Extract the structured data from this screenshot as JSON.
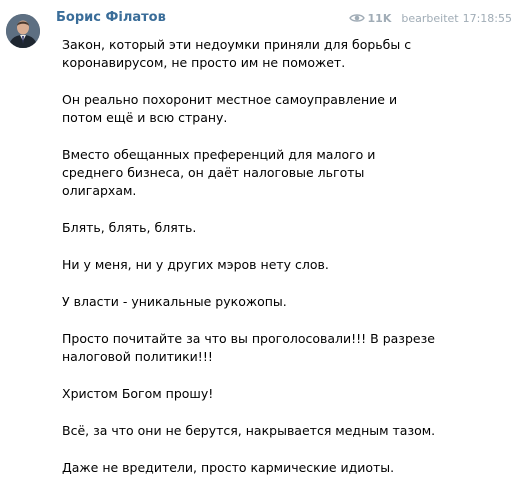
{
  "message": {
    "author": "Борис Філатов",
    "views": "11K",
    "signature": "bearbeitet",
    "time": "17:18:55",
    "avatar_icon": "user-photo",
    "views_icon": "eye-icon",
    "colors": {
      "author": "#3a6d99",
      "meta": "#a0acb6",
      "text": "#000000"
    },
    "paragraphs": [
      "Закон, который эти недоумки приняли для борьбы с\nкоронавирусом, не просто им не поможет.",
      "Он реально похоронит местное самоуправление и\nпотом ещё и всю страну.",
      "Вместо обещанных преференций для малого и\nсреднего бизнеса,  он даёт налоговые льготы\nолигархам.",
      "Блять, блять, блять.",
      "Ни у меня, ни у других мэров нету слов.",
      "У власти - уникальные рукожопы.",
      "Просто почитайте за что вы проголосовали!!! В разрезе\nналоговой политики!!!",
      "Христом Богом прошу!",
      "Всё, за что они не берутся, накрывается медным тазом.",
      "Даже не вредители, просто кармические идиоты."
    ]
  }
}
